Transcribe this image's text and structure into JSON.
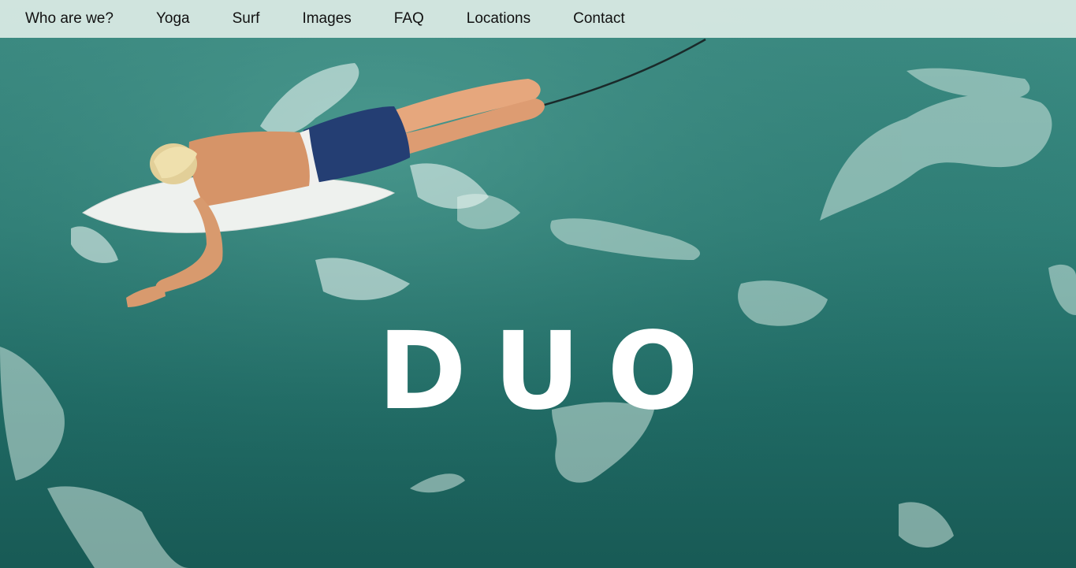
{
  "nav": {
    "items": [
      {
        "label": "Who are we?"
      },
      {
        "label": "Yoga"
      },
      {
        "label": "Surf"
      },
      {
        "label": "Images"
      },
      {
        "label": "FAQ"
      },
      {
        "label": "Locations"
      },
      {
        "label": "Contact"
      }
    ]
  },
  "hero": {
    "title": "DUO",
    "image": "surfer-paddling-on-surfboard-in-teal-ocean"
  },
  "colors": {
    "nav_bg": "#dcebe6",
    "ocean": "#2f7f77",
    "title": "#ffffff"
  }
}
